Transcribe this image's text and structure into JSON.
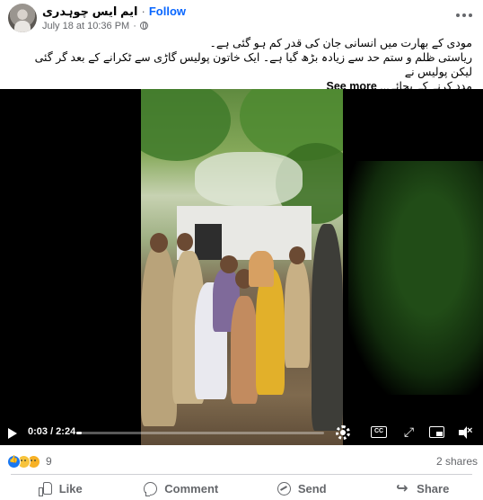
{
  "post": {
    "author": "ایم ایس چوہدری",
    "separator": "·",
    "follow_label": "Follow",
    "timestamp": "July 18 at 10:36 PM",
    "meta_separator": "·",
    "privacy_icon": "globe-icon",
    "caption_lines": [
      "مودی کے بھارت میں انسانی جان کی قدر کم ہو گئی ہے۔",
      "ریاستی ظلم و ستم حد سے زیادہ بڑھ گیا ہے۔ ایک خاتون پولیس گاڑی سے ٹکرانے کے بعد گر گئی لیکن پولیس نے",
      "مدد کرنے کے بجائے..."
    ],
    "see_more_label": "See more"
  },
  "video": {
    "current_time": "0:03",
    "duration": "2:24",
    "time_display": "0:03 / 2:24",
    "progress_fraction": 0.021,
    "cc_label": "CC"
  },
  "engagement": {
    "reaction_types": [
      "like",
      "sad",
      "wow"
    ],
    "reaction_count": "9",
    "shares_label": "2 shares"
  },
  "actions": [
    {
      "label": "Like",
      "icon": "like-icon"
    },
    {
      "label": "Comment",
      "icon": "comment-icon"
    },
    {
      "label": "Send",
      "icon": "send-icon"
    },
    {
      "label": "Share",
      "icon": "share-icon"
    }
  ],
  "colors": {
    "link_blue": "#0866ff",
    "secondary_text": "#65676b",
    "divider": "#ced0d4",
    "like_blue": "#1877f2"
  }
}
